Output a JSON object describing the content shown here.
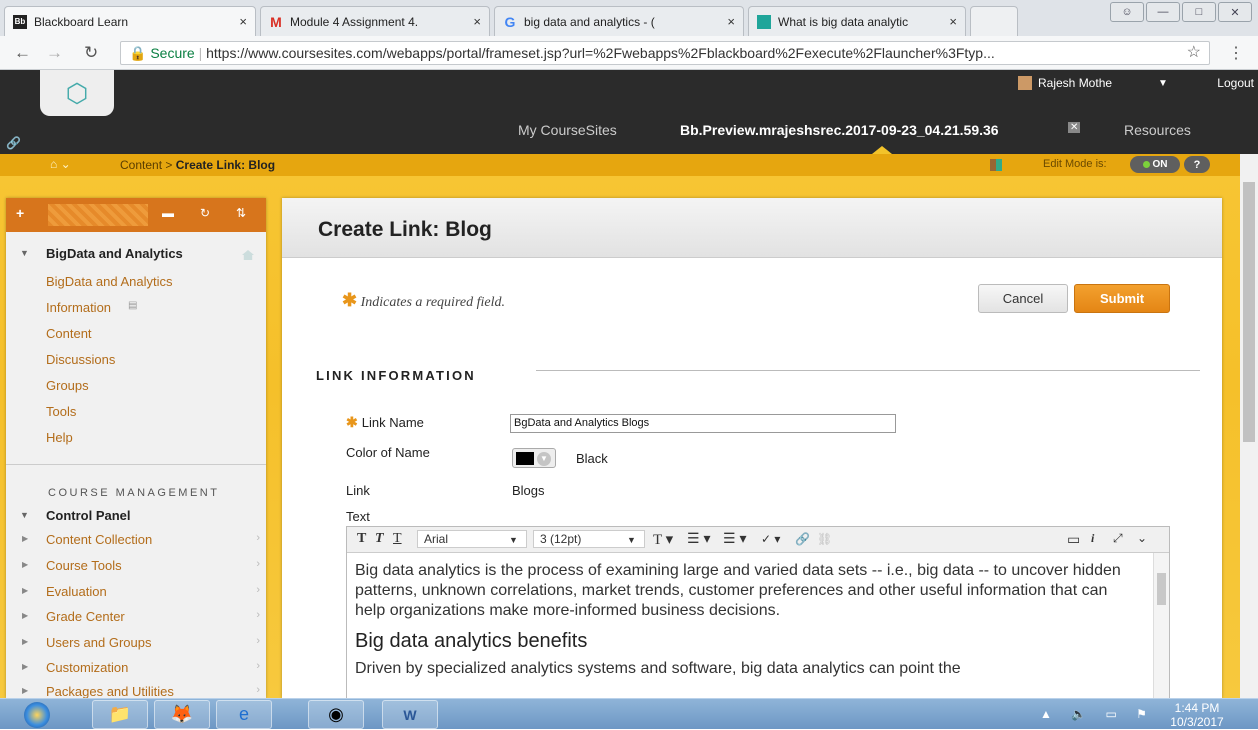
{
  "browser": {
    "tabs": [
      {
        "label": "Blackboard Learn",
        "icon": "blackboard-icon"
      },
      {
        "label": "Module 4 Assignment 4.",
        "icon": "gmail-icon"
      },
      {
        "label": "big data and analytics - (",
        "icon": "google-icon"
      },
      {
        "label": "What is big data analytic",
        "icon": "techtarget-icon"
      }
    ],
    "secure_label": "Secure",
    "url": "https://www.coursesites.com/webapps/portal/frameset.jsp?url=%2Fwebapps%2Fblackboard%2Fexecute%2Flauncher%3Ftyp..."
  },
  "header": {
    "user_name": "Rajesh Mothe",
    "logout": "Logout",
    "nav_my_coursesites": "My CourseSites",
    "nav_course": "Bb.Preview.mrajeshsrec.2017-09-23_04.21.59.36",
    "nav_resources": "Resources"
  },
  "breadcrumb": {
    "parent": "Content",
    "separator": ">",
    "current": "Create Link: Blog",
    "edit_mode_label": "Edit Mode is:",
    "edit_mode_value": "ON",
    "help": "?"
  },
  "sidebar": {
    "course_title": "BigData and Analytics",
    "course_links": [
      "BigData and Analytics",
      "Information",
      "Content",
      "Discussions",
      "Groups",
      "Tools",
      "Help"
    ],
    "management_label": "COURSE MANAGEMENT",
    "control_panel": "Control Panel",
    "control_items": [
      "Content Collection",
      "Course Tools",
      "Evaluation",
      "Grade Center",
      "Users and Groups",
      "Customization",
      "Packages and Utilities"
    ]
  },
  "form": {
    "page_title": "Create Link: Blog",
    "required_note": "Indicates a required field.",
    "cancel": "Cancel",
    "submit": "Submit",
    "section": "LINK INFORMATION",
    "link_name_label": "Link Name",
    "link_name_value": "BgData and Analytics Blogs",
    "color_label": "Color of Name",
    "color_value": "Black",
    "link_label": "Link",
    "link_value": "Blogs",
    "text_label": "Text",
    "font_family": "Arial",
    "font_size": "3 (12pt)",
    "body_paragraph": "Big data analytics is the process of examining large and varied data sets -- i.e., big data -- to uncover hidden patterns, unknown correlations, market trends, customer preferences and other useful information that can help organizations make more-informed business decisions.",
    "body_heading": "Big data analytics benefits",
    "body_cut": "Driven by specialized analytics systems and software, big data analytics can point the"
  },
  "taskbar": {
    "time": "1:44 PM",
    "date": "10/3/2017"
  },
  "colors": {
    "accent_orange": "#e48615",
    "banner_yellow": "#f5c02a",
    "header_dark": "#2b2b2b"
  }
}
